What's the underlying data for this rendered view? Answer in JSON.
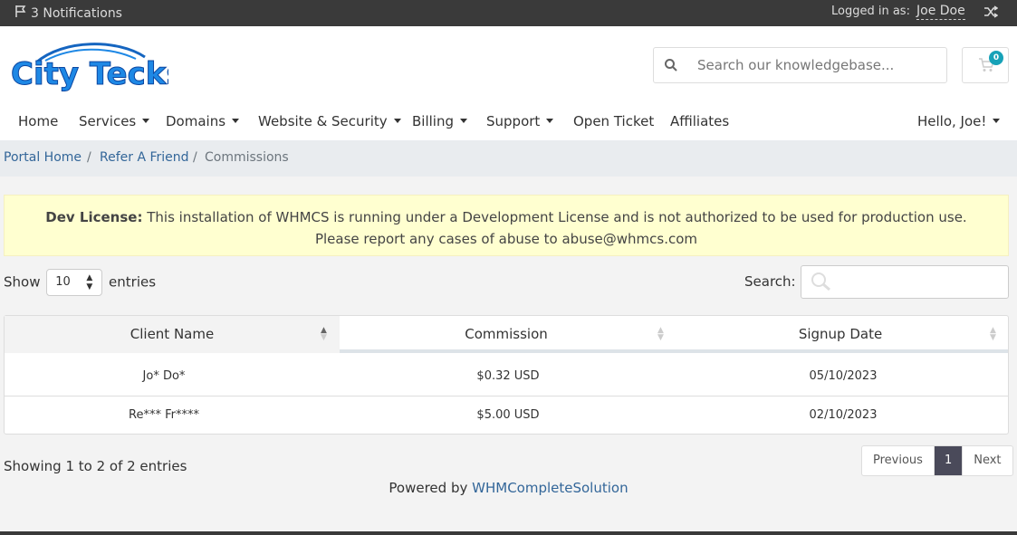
{
  "topbar": {
    "notifications": "3 Notifications",
    "logged_in_label": "Logged in as:",
    "user_name": "Joe Doe"
  },
  "header": {
    "logo_text": "City Tecks",
    "search_placeholder": "Search our knowledgebase...",
    "cart_count": "0"
  },
  "nav": {
    "items": [
      {
        "label": "Home",
        "dropdown": false
      },
      {
        "label": "Services",
        "dropdown": true
      },
      {
        "label": "Domains",
        "dropdown": true
      },
      {
        "label": "Website & Security",
        "dropdown": true
      },
      {
        "label": "Billing",
        "dropdown": true
      },
      {
        "label": "Support",
        "dropdown": true
      },
      {
        "label": "Open Ticket",
        "dropdown": false
      },
      {
        "label": "Affiliates",
        "dropdown": false
      }
    ],
    "account": "Hello, Joe!"
  },
  "breadcrumb": {
    "items": [
      "Portal Home",
      "Refer A Friend",
      "Commissions"
    ],
    "separator": "/"
  },
  "alert": {
    "title": "Dev License:",
    "line1": "This installation of WHMCS is running under a Development License and is not authorized to be used for production use.",
    "line2": "Please report any cases of abuse to abuse@whmcs.com"
  },
  "table_controls": {
    "show_label": "Show",
    "entries_label": "entries",
    "page_size": "10",
    "search_label": "Search:"
  },
  "table": {
    "columns": [
      "Client Name",
      "Commission",
      "Signup Date"
    ],
    "rows": [
      [
        "Jo* Do*",
        "$0.32 USD",
        "05/10/2023"
      ],
      [
        "Re*** Fr****",
        "$5.00 USD",
        "02/10/2023"
      ]
    ]
  },
  "footer": {
    "info": "Showing 1 to 2 of 2 entries",
    "pagination": {
      "previous": "Previous",
      "current": "1",
      "next": "Next"
    },
    "powered_by": "Powered by",
    "powered_link": "WHMCompleteSolution"
  },
  "colors": {
    "topbar": "#3a3a3a",
    "link": "#336699",
    "alert_bg": "#ffffd0",
    "badge": "#17a2b8",
    "logo_blue": "#1565c0"
  },
  "icons": [
    "flag-icon",
    "shuffle-icon",
    "search-icon",
    "cart-icon",
    "sort-icon"
  ]
}
